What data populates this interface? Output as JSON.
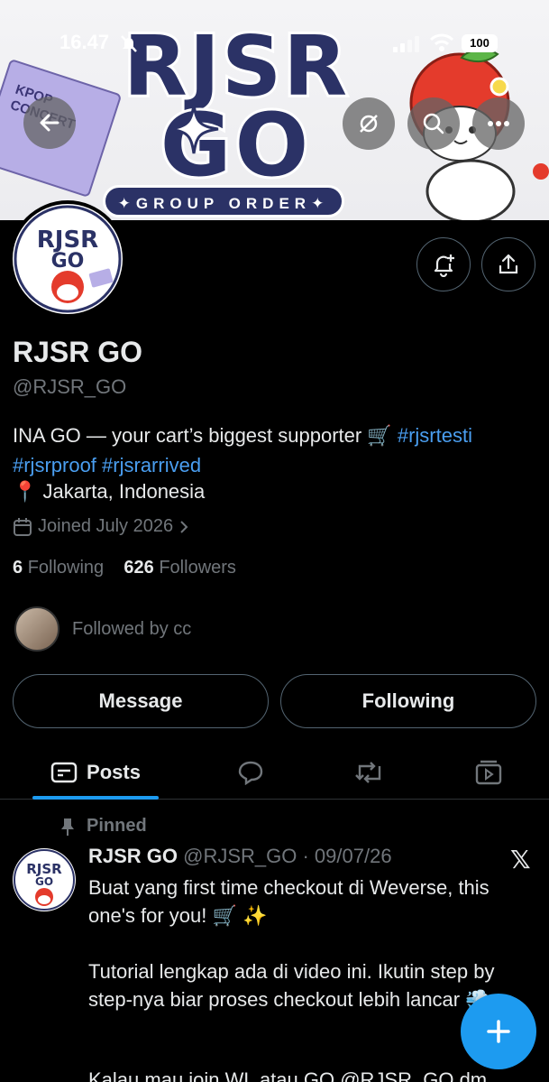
{
  "status_bar": {
    "time": "16.47",
    "battery": "100"
  },
  "banner": {
    "title_line1": "RJSR",
    "title_line2": "GO",
    "subtitle": "✦GROUP ORDER✦",
    "ticket_text": "KPOP\nCONCERT"
  },
  "profile": {
    "display_name": "RJSR GO",
    "handle": "@RJSR_GO",
    "bio_text": "INA GO — your cart’s biggest supporter 🛒 ",
    "bio_tag1": "#rjsrtesti",
    "bio_tag2": "#rjsrproof",
    "bio_tag3": "#rjsrarrived",
    "location": "📍 Jakarta, Indonesia",
    "joined": "Joined July 2026",
    "following_count": "6",
    "following_label": "Following",
    "followers_count": "626",
    "followers_label": "Followers",
    "followed_by": "Followed by cc",
    "avatar_text": "RJSR GO"
  },
  "buttons": {
    "message": "Message",
    "following": "Following"
  },
  "tabs": {
    "posts": "Posts"
  },
  "post": {
    "pinned_label": "Pinned",
    "author": "RJSR GO",
    "meta": " @RJSR_GO · 09/07/26",
    "line1": "Buat yang first time checkout di Weverse, this one's for you! 🛒 ✨",
    "line2": "Tutorial lengkap ada di video ini. Ikutin step by step-nya biar proses checkout lebih lancar 💨",
    "line3": "Kalau mau join WL atau GO @RJSR_GO dm"
  },
  "colors": {
    "accent": "#1d9bf0",
    "muted": "#71767b",
    "text": "#e7e9ea",
    "border": "#536471",
    "brand_navy": "#2b3266"
  }
}
